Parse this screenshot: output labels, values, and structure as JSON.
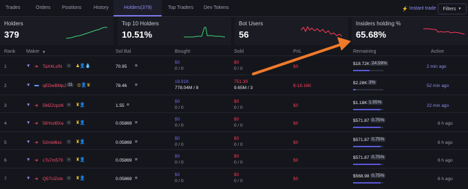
{
  "tabs": [
    "Trades",
    "Orders",
    "Positions",
    "History",
    "Holders(379)",
    "Top Traders",
    "Dev Tokens"
  ],
  "active_tab": "Holders(379)",
  "instant_trade": "Instant trade",
  "filters": "Filters",
  "cards": [
    {
      "title": "Holders",
      "value": "379"
    },
    {
      "title": "Top 10 Holders",
      "value": "10.51%"
    },
    {
      "title": "Bot Users",
      "value": "56"
    },
    {
      "title": "Insiders holding %",
      "value": "65.68%"
    }
  ],
  "columns": {
    "rank": "Rank",
    "maker": "Maker",
    "sol_bal": "Sol Bal",
    "bought": "Bought",
    "sold": "Sold",
    "pnl": "PnL",
    "remaining": "Remaining",
    "active": "Active"
  },
  "rows": [
    {
      "rank": "1",
      "addr": "TaX4LsfN",
      "badge": "-",
      "sol": "70.95",
      "bought": "$0",
      "bought2": "0 / 0",
      "sold": "$0",
      "sold2": "0 / 0",
      "pnl": "$0",
      "remaining": "$18.72K",
      "pct": "24.59%",
      "pct_value": 0.2459,
      "active": "2 min ago"
    },
    {
      "rank": "2",
      "addr": "qEDwBMpJ",
      "badge": "11",
      "sol": "78.46",
      "bought": "18.91K",
      "bought2": "778.04M / 8",
      "sold": "751.39",
      "sold2": "9.65M / 3",
      "pnl": "$-18.16K",
      "remaining": "$2.28K",
      "pct": "3%",
      "pct_value": 0.03,
      "active": "52 min ago"
    },
    {
      "rank": "3",
      "addr": "5MZ2cpz6",
      "badge": "-",
      "sol": "1.55",
      "bought": "$0",
      "bought2": "0 / 0",
      "sold": "$0",
      "sold2": "0 / 0",
      "pnl": "$0",
      "remaining": "$1.18K",
      "pct": "1.55%",
      "pct_value": 0.0155,
      "active": "22 min ago"
    },
    {
      "rank": "4",
      "addr": "58YozBXa",
      "badge": "-",
      "sol": "0.05869",
      "bought": "$0",
      "bought2": "0 / 0",
      "sold": "$0",
      "sold2": "0 / 0",
      "pnl": "$0",
      "remaining": "$571.87",
      "pct": "0.75%",
      "pct_value": 0.0075,
      "active": "6 h ago"
    },
    {
      "rank": "5",
      "addr": "52mid6xc",
      "badge": "-",
      "sol": "0.05869",
      "bought": "$0",
      "bought2": "0 / 0",
      "sold": "$0",
      "sold2": "0 / 0",
      "pnl": "$0",
      "remaining": "$571.87",
      "pct": "0.75%",
      "pct_value": 0.0075,
      "active": "6 h ago"
    },
    {
      "rank": "6",
      "addr": "cTs7m579",
      "badge": "-",
      "sol": "0.05869",
      "bought": "$0",
      "bought2": "0 / 0",
      "sold": "$0",
      "sold2": "0 / 0",
      "pnl": "$0",
      "remaining": "$571.87",
      "pct": "0.75%",
      "pct_value": 0.0075,
      "active": "6 h ago"
    },
    {
      "rank": "7",
      "addr": "Q57UZotx",
      "badge": "-",
      "sol": "0.05869",
      "bought": "$0",
      "bought2": "0 / 0",
      "sold": "$0",
      "sold2": "0 / 0",
      "pnl": "$0",
      "remaining": "$568.98",
      "pct": "0.75%",
      "pct_value": 0.0075,
      "active": "6 h ago"
    }
  ],
  "colors": {
    "accent": "#7a76ea",
    "red": "#ff3b57",
    "green": "#41d37a",
    "arrow": "#f07a2a"
  }
}
